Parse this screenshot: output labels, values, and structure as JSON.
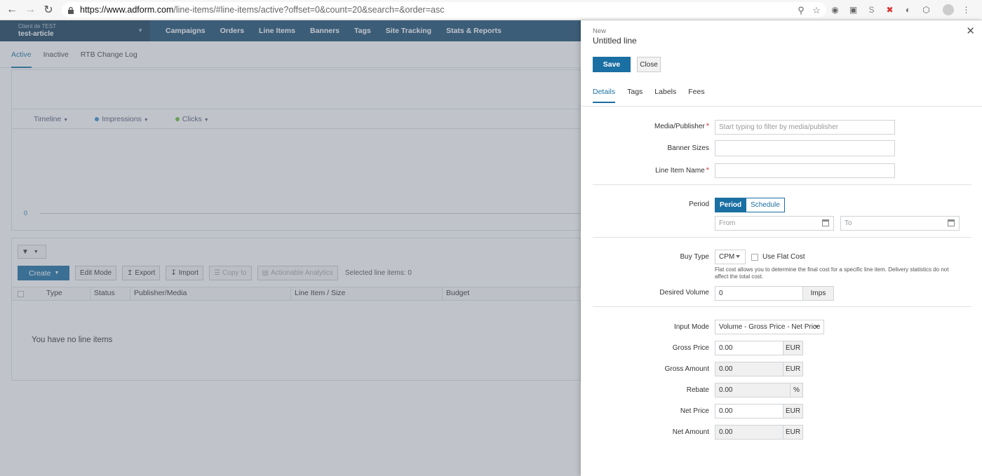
{
  "browser": {
    "url_host": "https://www.adform.com",
    "url_rest": "/line-items/#line-items/active?offset=0&count=20&search=&order=asc"
  },
  "app": {
    "client_label": "Client de TEST",
    "client_name": "test-article",
    "nav": [
      "Campaigns",
      "Orders",
      "Line Items",
      "Banners",
      "Tags",
      "Site Tracking",
      "Stats & Reports"
    ],
    "subtabs": [
      "Active",
      "Inactive",
      "RTB Change Log"
    ],
    "legend": {
      "timeline": "Timeline",
      "impressions": "Impressions",
      "clicks": "Clicks"
    },
    "axis_zero": "0",
    "toolbar": {
      "create": "Create",
      "edit_mode": "Edit Mode",
      "export": "Export",
      "import": "Import",
      "copy_to": "Copy to",
      "actionable_analytics": "Actionable Analytics",
      "selected": "Selected line items: 0"
    },
    "columns": [
      "Type",
      "Status",
      "Publisher/Media",
      "Line Item / Size",
      "Budget"
    ],
    "empty_text": "You have no line items"
  },
  "panel": {
    "kicker": "New",
    "title": "Untitled line",
    "save": "Save",
    "close": "Close",
    "tabs": [
      "Details",
      "Tags",
      "Labels",
      "Fees"
    ],
    "fields": {
      "media_publisher_label": "Media/Publisher",
      "media_publisher_placeholder": "Start typing to filter by media/publisher",
      "banner_sizes_label": "Banner Sizes",
      "line_item_name_label": "Line Item Name",
      "required_mark": "*",
      "period_label": "Period",
      "period_opt": "Period",
      "schedule_opt": "Schedule",
      "from_placeholder": "From",
      "to_placeholder": "To",
      "buy_type_label": "Buy Type",
      "buy_type_value": "CPM",
      "use_flat_cost": "Use Flat Cost",
      "flat_cost_hint": "Flat cost allows you to determine the final cost for a specific line item. Delivery statistics do not affect the total cost.",
      "desired_volume_label": "Desired Volume",
      "desired_volume_value": "0",
      "desired_volume_unit": "Imps",
      "input_mode_label": "Input Mode",
      "input_mode_value": "Volume - Gross Price - Net Price",
      "gross_price_label": "Gross Price",
      "gross_price_value": "0.00",
      "gross_amount_label": "Gross Amount",
      "gross_amount_value": "0.00",
      "rebate_label": "Rebate",
      "rebate_value": "0.00",
      "net_price_label": "Net Price",
      "net_price_value": "0.00",
      "net_amount_label": "Net Amount",
      "net_amount_value": "0.00",
      "currency": "EUR",
      "percent": "%"
    }
  },
  "colors": {
    "accent": "#1a6fa3",
    "nav_bg": "#1d4f72",
    "impressions_dot": "#3b8fd0",
    "clicks_dot": "#6bbf3a"
  }
}
